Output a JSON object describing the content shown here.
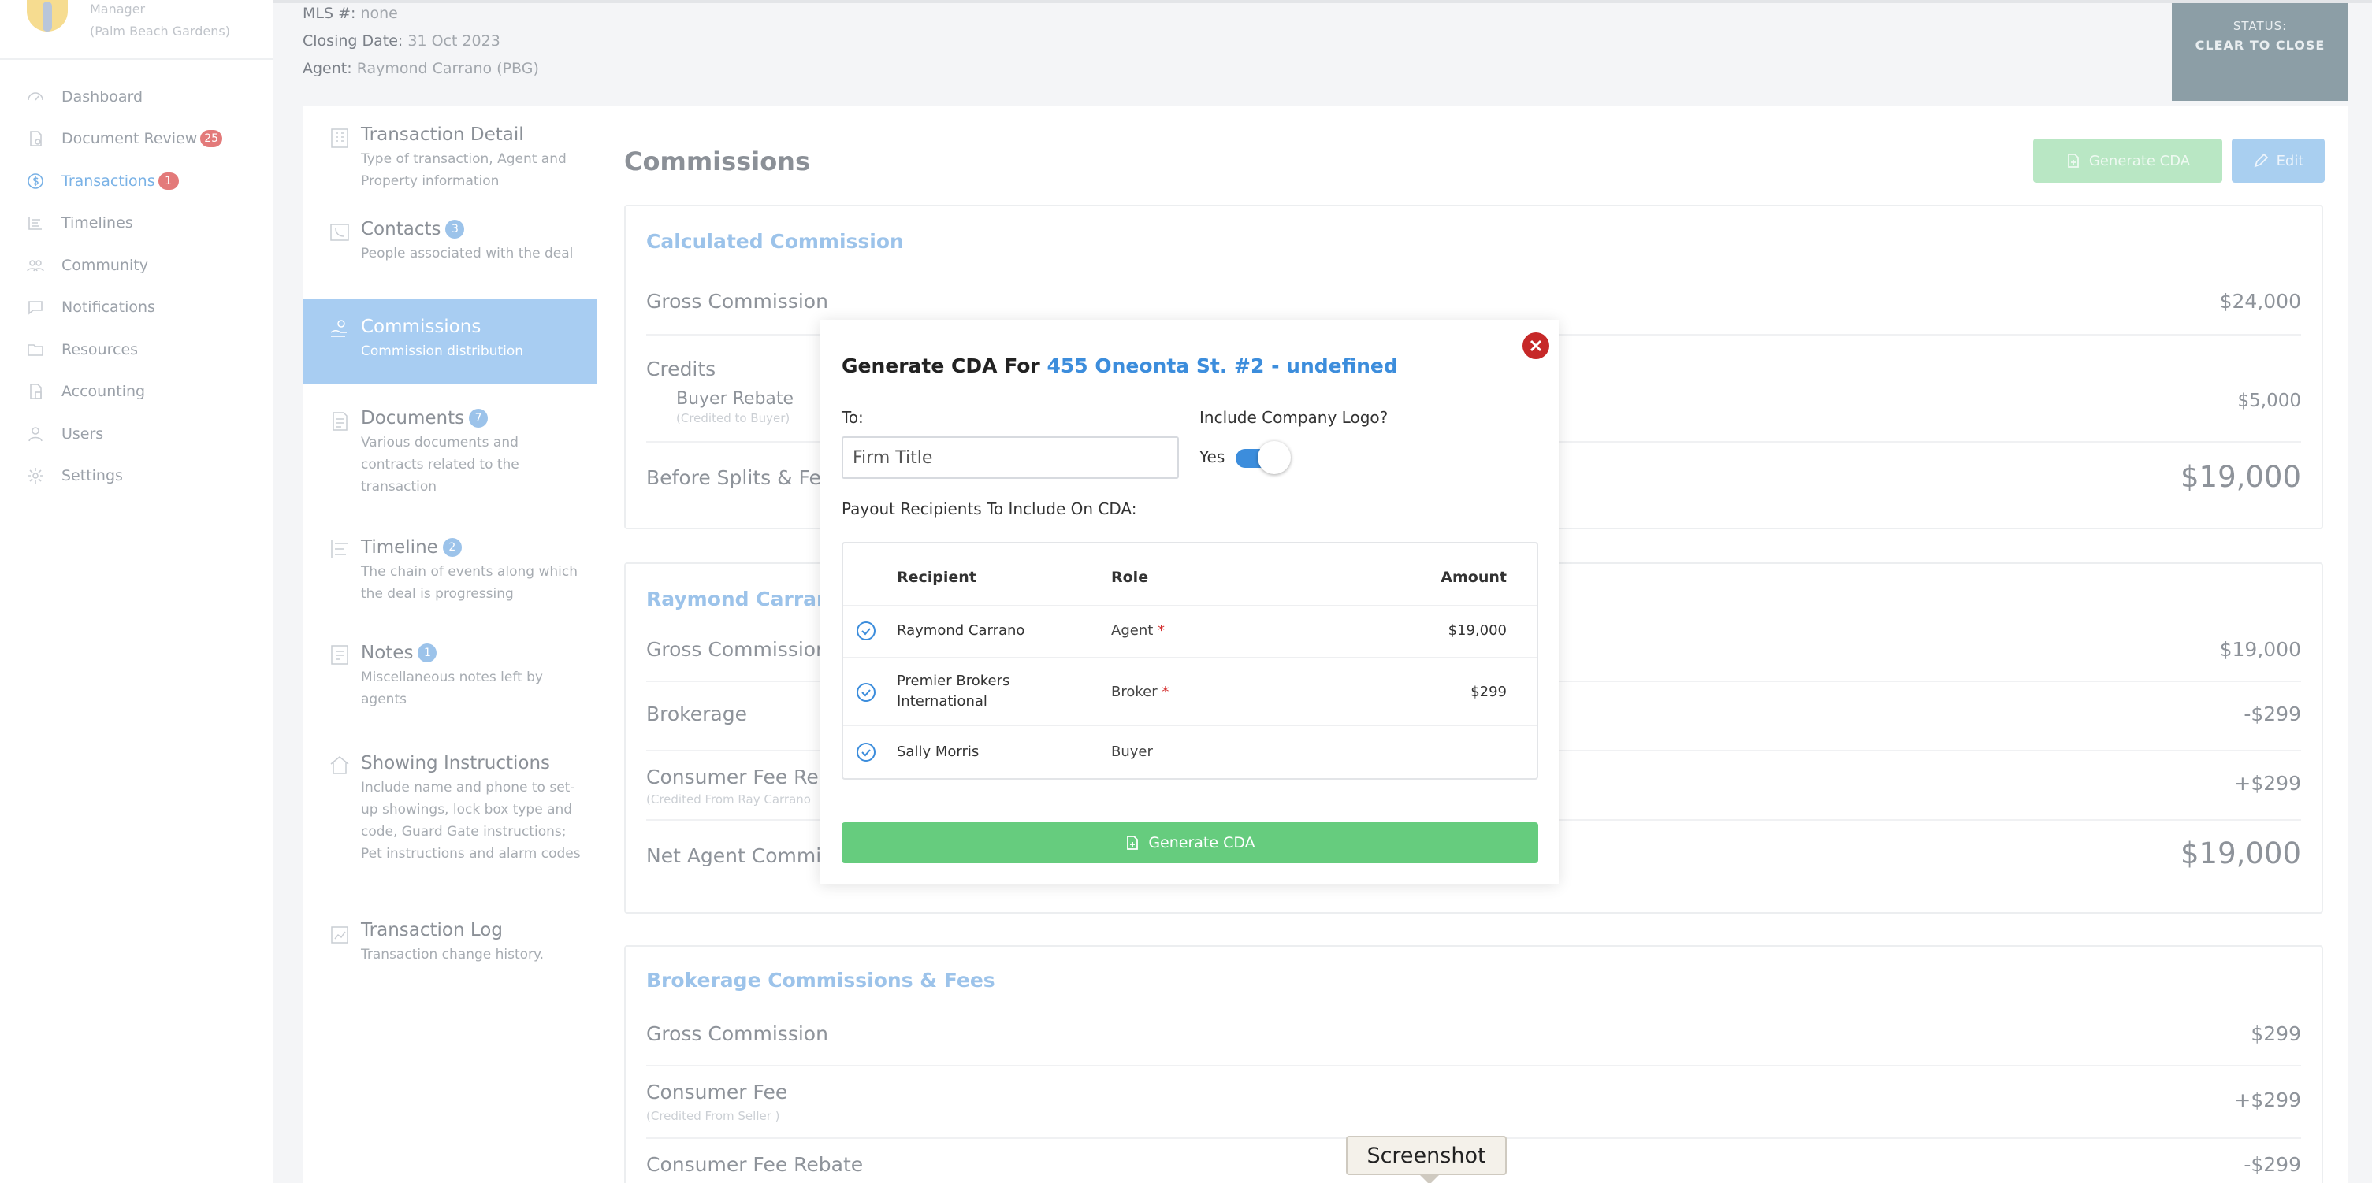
{
  "user": {
    "role": "Manager",
    "office": "(Palm Beach Gardens)"
  },
  "nav": [
    {
      "label": "Dashboard",
      "icon": "dashboard-icon"
    },
    {
      "label": "Document Review",
      "icon": "document-review-icon",
      "badge": "25"
    },
    {
      "label": "Transactions",
      "icon": "dollar-icon",
      "badge": "1",
      "active": true
    },
    {
      "label": "Timelines",
      "icon": "timelines-icon"
    },
    {
      "label": "Community",
      "icon": "community-icon"
    },
    {
      "label": "Notifications",
      "icon": "notifications-icon"
    },
    {
      "label": "Resources",
      "icon": "resources-icon"
    },
    {
      "label": "Accounting",
      "icon": "accounting-icon"
    },
    {
      "label": "Users",
      "icon": "users-icon"
    },
    {
      "label": "Settings",
      "icon": "settings-icon"
    }
  ],
  "header": {
    "mls_label": "MLS #:",
    "mls_value": "none",
    "closing_label": "Closing Date:",
    "closing_value": "31 Oct 2023",
    "agent_label": "Agent:",
    "agent_value": "Raymond Carrano (PBG)",
    "status_label": "STATUS:",
    "status_value": "CLEAR TO CLOSE"
  },
  "tabs": [
    {
      "title": "Transaction Detail",
      "desc": "Type of transaction, Agent and Property information",
      "icon": "building-icon"
    },
    {
      "title": "Contacts",
      "badge": "3",
      "desc": "People associated with the deal",
      "icon": "phone-icon"
    },
    {
      "title": "Commissions",
      "desc": "Commission distribution",
      "icon": "commission-hand-icon",
      "active": true
    },
    {
      "title": "Documents",
      "badge": "7",
      "desc": "Various documents and contracts related to the transaction",
      "icon": "document-icon"
    },
    {
      "title": "Timeline",
      "badge": "2",
      "desc": "The chain of events along which the deal is progressing",
      "icon": "timeline-icon"
    },
    {
      "title": "Notes",
      "badge": "1",
      "desc": "Miscellaneous notes left by agents",
      "icon": "notes-icon"
    },
    {
      "title": "Showing Instructions",
      "desc": "Include name and phone to set-up showings, lock box type and code, Guard Gate instructions; Pet instructions and alarm codes",
      "icon": "house-icon"
    },
    {
      "title": "Transaction Log",
      "desc": "Transaction change history.",
      "icon": "log-icon"
    }
  ],
  "main": {
    "title": "Commissions",
    "generate_cda_label": "Generate CDA",
    "edit_label": "Edit",
    "calc": {
      "title": "Calculated Commission",
      "gross_label": "Gross Commission",
      "gross_value": "$24,000",
      "credits_label": "Credits",
      "rebate_label": "Buyer Rebate",
      "rebate_sub": "(Credited to Buyer)",
      "rebate_value": "$5,000",
      "before_label": "Before Splits & Fee",
      "before_value": "$19,000"
    },
    "agent": {
      "title": "Raymond Carrano",
      "gross_label": "Gross Commission",
      "gross_value": "$19,000",
      "brokerage_label": "Brokerage",
      "brokerage_value": "-$299",
      "consumer_rebate_label": "Consumer Fee Reba",
      "consumer_rebate_sub": "(Credited From Ray Carrano",
      "consumer_rebate_value": "+$299",
      "net_label": "Net Agent Commis",
      "net_value": "$19,000"
    },
    "brokerage": {
      "title": "Brokerage Commissions & Fees",
      "gross_label": "Gross Commission",
      "gross_value": "$299",
      "consumer_fee_label": "Consumer Fee",
      "consumer_fee_sub": "(Credited From Seller )",
      "consumer_fee_value": "+$299",
      "consumer_rebate_label": "Consumer Fee Rebate",
      "consumer_rebate_value": "-$299"
    }
  },
  "modal": {
    "title_prefix": "Generate CDA For",
    "title_address": "455 Oneonta St. #2 - undefined",
    "to_label": "To:",
    "to_value": "Firm Title",
    "logo_label": "Include Company Logo?",
    "logo_toggle_text": "Yes",
    "logo_toggle_on": true,
    "payout_label": "Payout Recipients To Include On CDA:",
    "columns": {
      "recipient": "Recipient",
      "role": "Role",
      "amount": "Amount"
    },
    "recipients": [
      {
        "name": "Raymond Carrano",
        "role": "Agent",
        "required": "*",
        "amount": "$19,000",
        "checked": true
      },
      {
        "name": "Premier Brokers International",
        "role": "Broker",
        "required": "*",
        "amount": "$299",
        "checked": true
      },
      {
        "name": "Sally Morris",
        "role": "Buyer",
        "required": "",
        "amount": "",
        "checked": true
      }
    ],
    "generate_label": "Generate CDA"
  },
  "tooltip": {
    "label": "Screenshot"
  },
  "colors": {
    "accent": "#3c8ddc",
    "success": "#66cc7e",
    "danger": "#c62828",
    "status_bg": "#8c9ea6"
  }
}
